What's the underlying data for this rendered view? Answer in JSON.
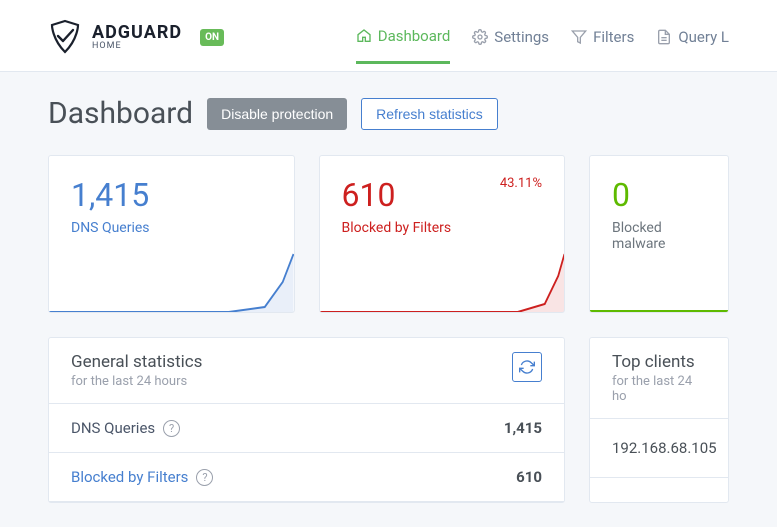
{
  "brand": {
    "name": "ADGUARD",
    "sub": "HOME",
    "badge": "ON"
  },
  "nav": {
    "dashboard": "Dashboard",
    "settings": "Settings",
    "filters": "Filters",
    "querylog": "Query L"
  },
  "title": "Dashboard",
  "buttons": {
    "disable": "Disable protection",
    "refresh": "Refresh statistics"
  },
  "cards": {
    "dns": {
      "value": "1,415",
      "label": "DNS Queries"
    },
    "blocked": {
      "value": "610",
      "label": "Blocked by Filters",
      "pct": "43.11%"
    },
    "malware": {
      "value": "0",
      "label": "Blocked malware"
    }
  },
  "stats": {
    "title": "General statistics",
    "sub": "for the last 24 hours",
    "rows": {
      "dns": {
        "label": "DNS Queries",
        "val": "1,415"
      },
      "blocked": {
        "label": "Blocked by Filters",
        "val": "610"
      }
    }
  },
  "clients": {
    "title": "Top clients",
    "sub": "for the last 24 ho",
    "rows": {
      "r0": "192.168.68.105"
    }
  }
}
